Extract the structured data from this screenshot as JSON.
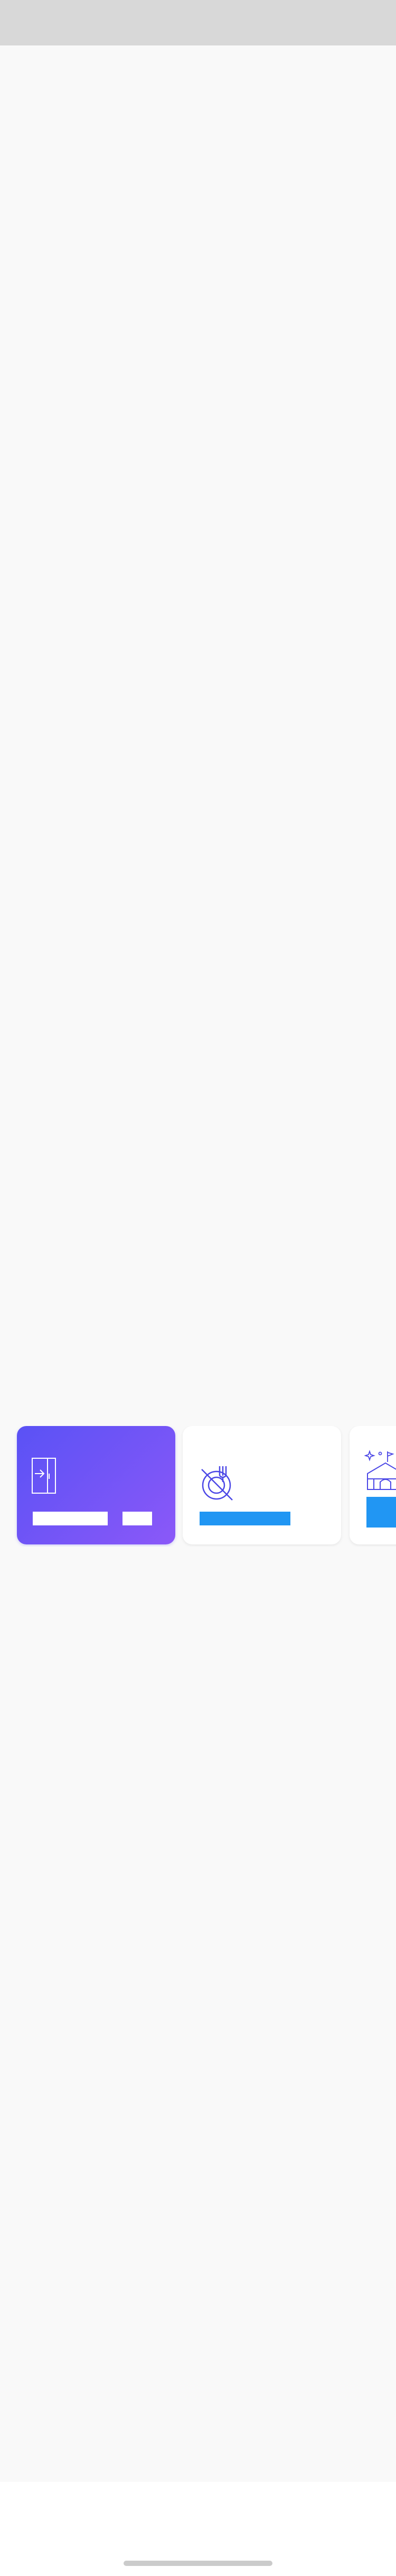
{
  "status_bar": {},
  "carousel": {
    "cards": [
      {
        "icon": "door-enter-icon",
        "labels": [
          "",
          ""
        ],
        "label_color": "#ffffff",
        "background": [
          "#5a52f5",
          "#8b58f8"
        ]
      },
      {
        "icon": "no-food-icon",
        "labels": [
          ""
        ],
        "label_color": "#2196f3",
        "background": "#ffffff"
      },
      {
        "icon": "venue-sparkle-icon",
        "labels": [
          ""
        ],
        "label_color": "#2196f3",
        "background": "#ffffff"
      }
    ]
  },
  "colors": {
    "accent_purple": "#6a4cf6",
    "accent_blue": "#2196f3",
    "page_background": "#f9f9f9",
    "status_bar": "#d8d8d8",
    "home_indicator": "#cbcbcb"
  }
}
